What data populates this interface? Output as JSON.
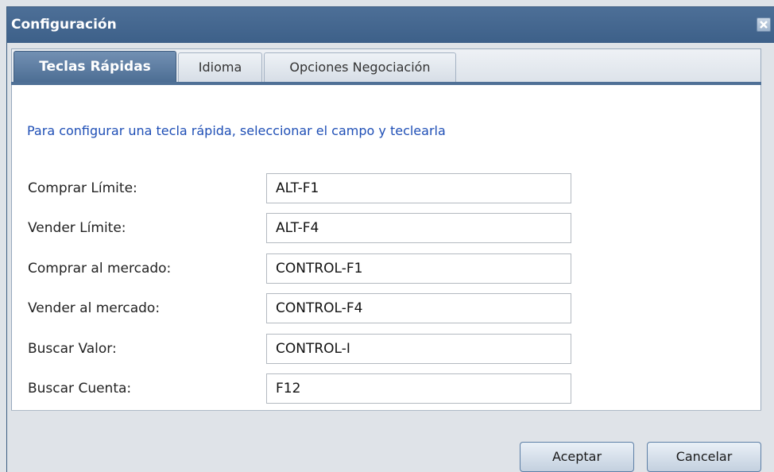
{
  "window": {
    "title": "Configuración"
  },
  "tabs": [
    {
      "label": "Teclas Rápidas",
      "active": true
    },
    {
      "label": "Idioma",
      "active": false
    },
    {
      "label": "Opciones Negociación",
      "active": false
    }
  ],
  "panel": {
    "instruction": "Para configurar una tecla rápida, seleccionar el campo y teclearla",
    "rows": [
      {
        "label": "Comprar Límite:",
        "value": "ALT-F1"
      },
      {
        "label": "Vender Límite:",
        "value": "ALT-F4"
      },
      {
        "label": "Comprar al mercado:",
        "value": "CONTROL-F1"
      },
      {
        "label": "Vender al mercado:",
        "value": "CONTROL-F4"
      },
      {
        "label": "Buscar Valor:",
        "value": "CONTROL-I"
      },
      {
        "label": "Buscar Cuenta:",
        "value": "F12"
      }
    ]
  },
  "buttons": {
    "accept": "Aceptar",
    "cancel": "Cancelar"
  },
  "icons": {
    "close": "close-icon"
  },
  "colors": {
    "titlebar": "#3d6089",
    "active_tab": "#4c6d93",
    "instruction_text": "#1f4fb6"
  }
}
